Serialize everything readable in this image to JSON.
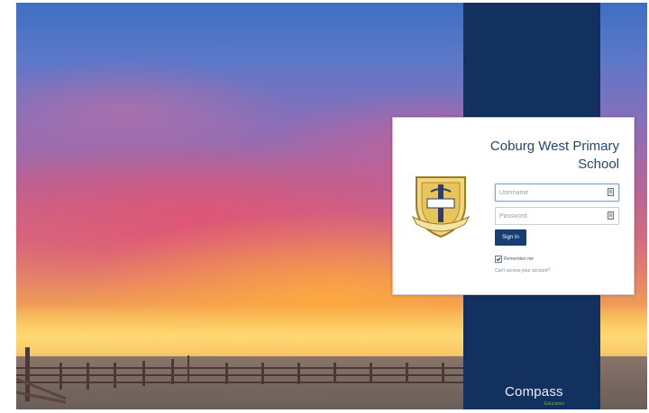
{
  "school": {
    "title_line1": "Coburg West Primary",
    "title_line2": "School"
  },
  "login": {
    "username_placeholder": "Username",
    "password_placeholder": "Password",
    "signin_label": "Sign In",
    "remember_label": "Remember me",
    "remember_checked": true,
    "cant_access_label": "Can't access your account?"
  },
  "brand": {
    "name": "Compass",
    "sub": "Education",
    "panel_color": "#13315f",
    "accent_color": "#6fae3f"
  },
  "icons": {
    "username_field": "id-card-icon",
    "password_field": "id-card-icon",
    "checkbox": "checkmark-icon",
    "crest": "school-crest-icon"
  }
}
